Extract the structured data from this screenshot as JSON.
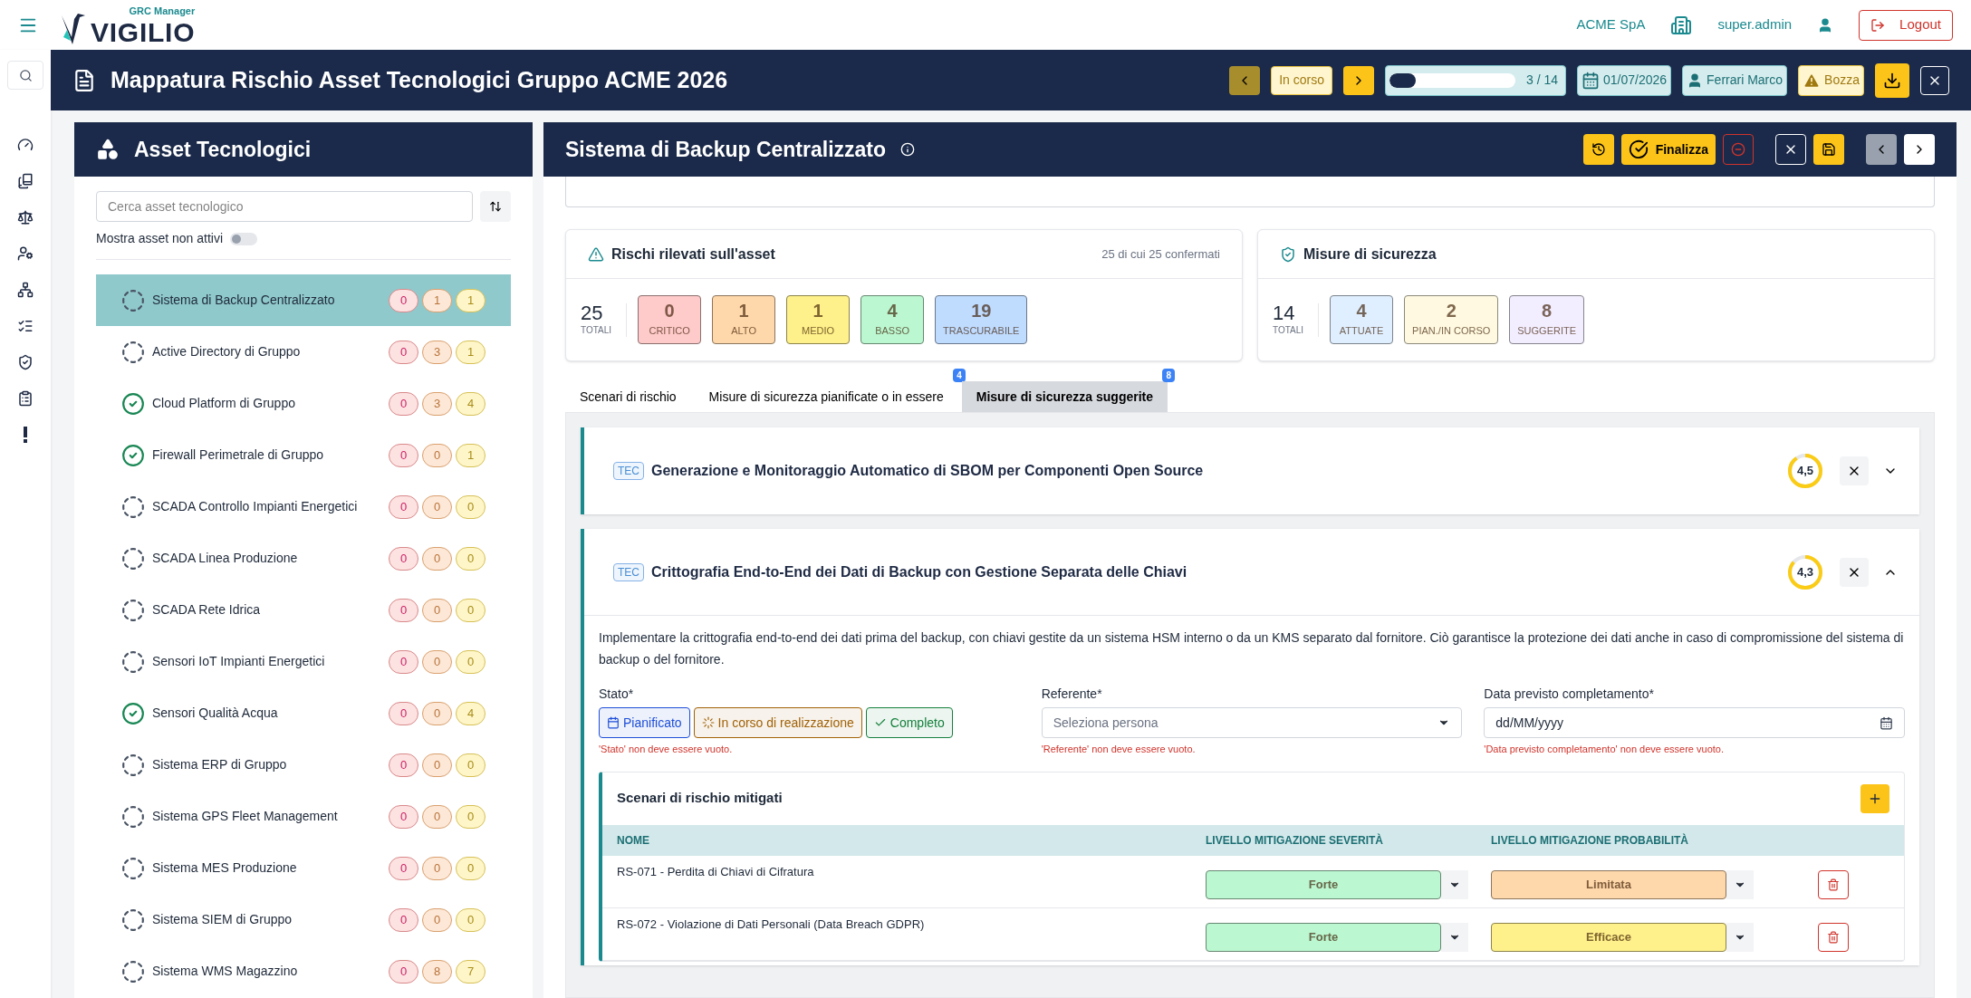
{
  "topbar": {
    "logo_sub": "GRC Manager",
    "logo_name": "VIGILIO",
    "company": "ACME SpA",
    "user": "super.admin",
    "logout": "Logout"
  },
  "header": {
    "title": "Mappatura Rischio Asset Tecnologici Gruppo ACME 2026",
    "status": "In corso",
    "progress": {
      "level": 0.21,
      "reading": "3 / 14"
    },
    "date": "01/07/2026",
    "owner": "Ferrari Marco",
    "state": "Bozza"
  },
  "assets": {
    "title": "Asset Tecnologici",
    "search": {
      "placeholder": "Cerca asset tecnologico"
    },
    "toggle": {
      "label": "Mostra asset non attivi",
      "on": false
    },
    "items": [
      {
        "name": "Sistema di Backup Centralizzato",
        "complete": false,
        "selected": true,
        "counts": [
          "0",
          "1",
          "1"
        ]
      },
      {
        "name": "Active Directory di Gruppo",
        "complete": false,
        "selected": false,
        "counts": [
          "0",
          "3",
          "1"
        ]
      },
      {
        "name": "Cloud Platform di Gruppo",
        "complete": true,
        "selected": false,
        "counts": [
          "0",
          "3",
          "4"
        ]
      },
      {
        "name": "Firewall Perimetrale di Gruppo",
        "complete": true,
        "selected": false,
        "counts": [
          "0",
          "0",
          "1"
        ]
      },
      {
        "name": "SCADA Controllo Impianti Energetici",
        "complete": false,
        "selected": false,
        "counts": [
          "0",
          "0",
          "0"
        ]
      },
      {
        "name": "SCADA Linea Produzione",
        "complete": false,
        "selected": false,
        "counts": [
          "0",
          "0",
          "0"
        ]
      },
      {
        "name": "SCADA Rete Idrica",
        "complete": false,
        "selected": false,
        "counts": [
          "0",
          "0",
          "0"
        ]
      },
      {
        "name": "Sensori IoT Impianti Energetici",
        "complete": false,
        "selected": false,
        "counts": [
          "0",
          "0",
          "0"
        ]
      },
      {
        "name": "Sensori Qualità Acqua",
        "complete": true,
        "selected": false,
        "counts": [
          "0",
          "0",
          "4"
        ]
      },
      {
        "name": "Sistema ERP di Gruppo",
        "complete": false,
        "selected": false,
        "counts": [
          "0",
          "0",
          "0"
        ]
      },
      {
        "name": "Sistema GPS Fleet Management",
        "complete": false,
        "selected": false,
        "counts": [
          "0",
          "0",
          "0"
        ]
      },
      {
        "name": "Sistema MES Produzione",
        "complete": false,
        "selected": false,
        "counts": [
          "0",
          "0",
          "0"
        ]
      },
      {
        "name": "Sistema SIEM di Gruppo",
        "complete": false,
        "selected": false,
        "counts": [
          "0",
          "0",
          "0"
        ]
      },
      {
        "name": "Sistema WMS Magazzino",
        "complete": false,
        "selected": false,
        "counts": [
          "0",
          "8",
          "7"
        ]
      }
    ]
  },
  "detail": {
    "title": "Sistema di Backup Centralizzato",
    "finalize": "Finalizza",
    "risks": {
      "title": "Rischi rilevati sull'asset",
      "note": "25 di cui 25 confermati",
      "total": "25",
      "total_label": "TOTALI",
      "levels": [
        {
          "value": "0",
          "label": "CRITICO",
          "color": "#fecaca"
        },
        {
          "value": "1",
          "label": "ALTO",
          "color": "#fed7aa"
        },
        {
          "value": "1",
          "label": "MEDIO",
          "color": "#fef08a"
        },
        {
          "value": "4",
          "label": "BASSO",
          "color": "#bbf7d0"
        },
        {
          "value": "19",
          "label": "TRASCURABILE",
          "color": "#bfdbfe"
        }
      ]
    },
    "measures": {
      "title": "Misure di sicurezza",
      "total": "14",
      "total_label": "TOTALI",
      "levels": [
        {
          "value": "4",
          "label": "ATTUATE",
          "color": "#e0efff"
        },
        {
          "value": "2",
          "label": "PIAN./IN CORSO",
          "color": "#fef9e0"
        },
        {
          "value": "8",
          "label": "SUGGERITE",
          "color": "#f3eeff"
        }
      ]
    },
    "tabs": [
      {
        "label": "Scenari di rischio",
        "selected": false
      },
      {
        "label": "Misure di sicurezza pianificate o in essere",
        "badge": "4",
        "selected": false
      },
      {
        "label": "Misure di sicurezza suggerite",
        "badge": "8",
        "selected": true
      }
    ],
    "suggestions": [
      {
        "tag": "TEC",
        "title": "Generazione e Monitoraggio Automatico di SBOM per Componenti Open Source",
        "score": "4,5",
        "level": 0.9,
        "expanded": false
      },
      {
        "tag": "TEC",
        "title": "Crittografia End-to-End dei Dati di Backup con Gestione Separata delle Chiavi",
        "score": "4,3",
        "level": 0.86,
        "expanded": true,
        "description": "Implementare la crittografia end-to-end dei dati prima del backup, con chiavi gestite da un sistema HSM interno o da un KMS separato dal fornitore. Ciò garantisce la protezione dei dati anche in caso di compromissione del sistema di backup o del fornitore.",
        "status_field": {
          "label": "Stato*",
          "error": "'Stato' non deve essere vuoto.",
          "options": [
            {
              "label": "Pianificato",
              "color": "#1d4ed8",
              "selected": false
            },
            {
              "label": "In corso di realizzazione",
              "color": "#a16207",
              "selected": false
            },
            {
              "label": "Completo",
              "color": "#15803d",
              "selected": false
            }
          ]
        },
        "owner_field": {
          "label": "Referente*",
          "placeholder": "Seleziona persona",
          "error": "'Referente' non deve essere vuoto."
        },
        "date_field": {
          "label": "Data previsto completamento*",
          "placeholder": "dd/MM/yyyy",
          "error": "'Data previsto completamento' non deve essere vuoto."
        },
        "scenarios": {
          "title": "Scenari di rischio mitigati",
          "columns": [
            "NOME",
            "LIVELLO MITIGAZIONE SEVERITÀ",
            "LIVELLO MITIGAZIONE PROBABILITÀ"
          ],
          "rows": [
            {
              "name": "RS-071 - Perdita di Chiavi di Cifratura",
              "severity": {
                "value": "Forte",
                "color": "#bbf7d0"
              },
              "probability": {
                "value": "Limitata",
                "color": "#fed7aa"
              }
            },
            {
              "name": "RS-072 - Violazione di Dati Personali (Data Breach GDPR)",
              "severity": {
                "value": "Forte",
                "color": "#bbf7d0"
              },
              "probability": {
                "value": "Efficace",
                "color": "#fef08a"
              }
            }
          ]
        }
      }
    ]
  }
}
